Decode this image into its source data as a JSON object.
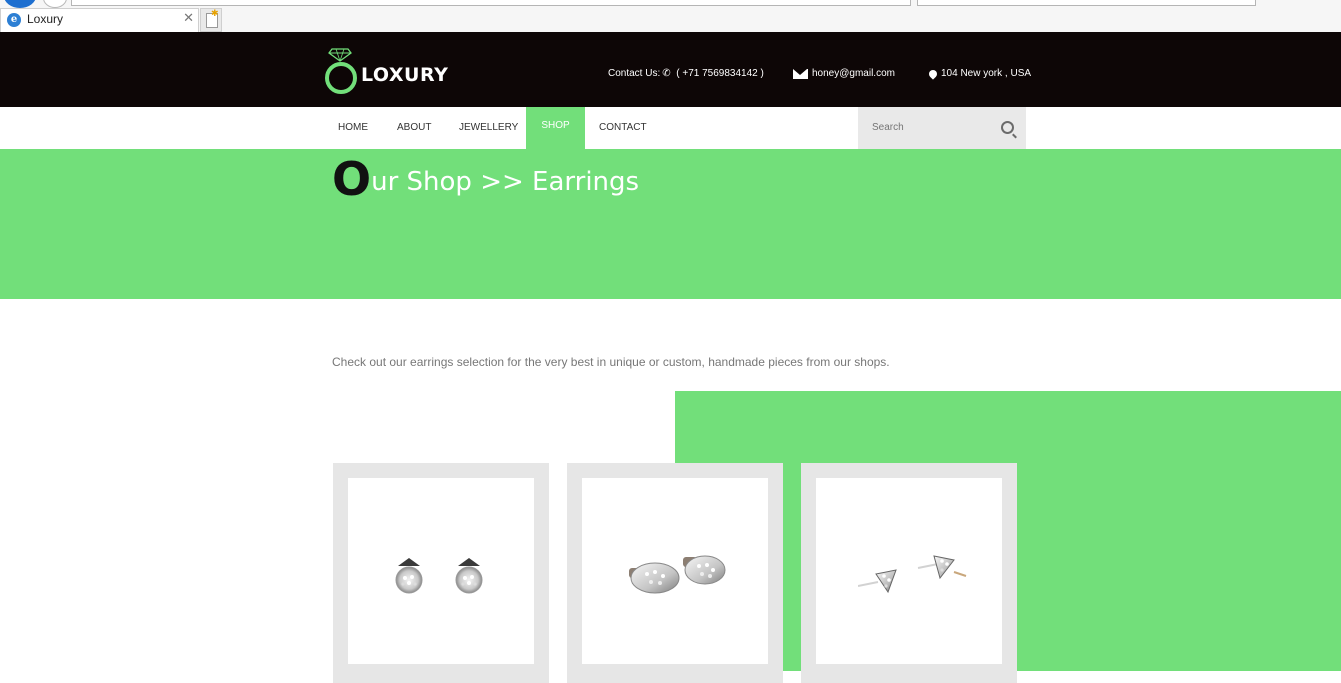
{
  "browser": {
    "tab_title": "Loxury"
  },
  "header": {
    "brand": "LOXURY",
    "contact_label": "Contact Us:",
    "phone": "( +71 7569834142 )",
    "email": "honey@gmail.com",
    "address": "104 New york , USA"
  },
  "nav": {
    "items": [
      "HOME",
      "ABOUT",
      "JEWELLERY",
      "SHOP",
      "CONTACT"
    ],
    "active": "SHOP",
    "search_placeholder": "Search"
  },
  "banner": {
    "first_letter": "O",
    "title_rest": "ur Shop >> Earrings"
  },
  "intro_text": "Check out our earrings selection for the very best in unique or custom, handmade pieces from our shops.",
  "colors": {
    "accent": "#72df7a",
    "header_bg": "#0d0606"
  },
  "products": [
    {
      "image": "round-cluster-earrings"
    },
    {
      "image": "oval-cluster-earrings"
    },
    {
      "image": "triangle-stud-earrings"
    }
  ]
}
